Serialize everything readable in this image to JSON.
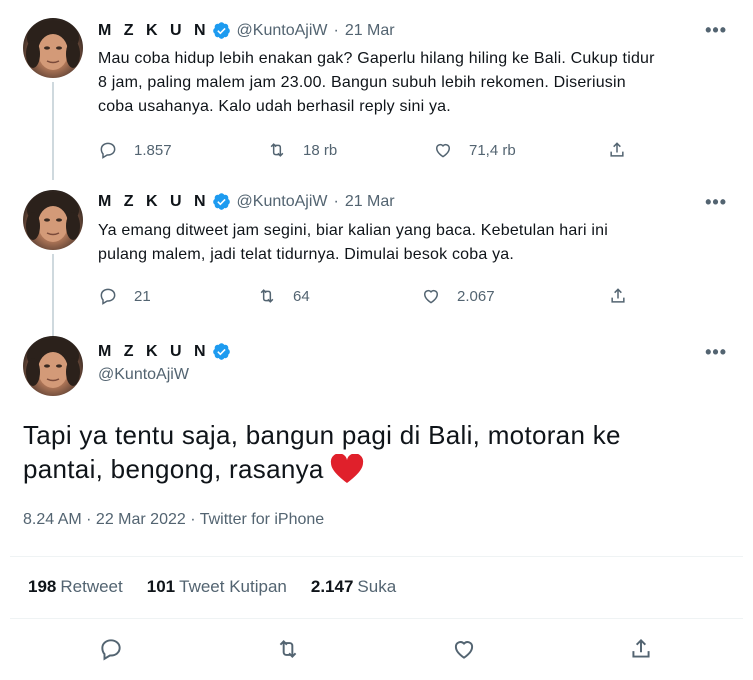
{
  "thread": [
    {
      "name": "M Z K U N",
      "handle": "@KuntoAjiW",
      "separator": "·",
      "date": "21 Mar",
      "text_lines": [
        "Mau coba hidup lebih enakan gak? Gaperlu hilang hiling ke Bali. Cukup tidur",
        "8 jam, paling malem jam 23.00. Bangun subuh lebih rekomen. Diseriusin",
        "coba usahanya. Kalo udah berhasil reply sini ya."
      ],
      "replies": "1.857",
      "retweets": "18 rb",
      "likes": "71,4 rb",
      "more": "•••"
    },
    {
      "name": "M Z K U N",
      "handle": "@KuntoAjiW",
      "separator": "·",
      "date": "21 Mar",
      "text_lines": [
        "Ya emang ditweet jam segini, biar kalian yang baca. Kebetulan hari ini",
        "pulang malem, jadi telat tidurnya. Dimulai besok coba ya."
      ],
      "replies": "21",
      "retweets": "64",
      "likes": "2.067",
      "more": "•••"
    }
  ],
  "main_tweet": {
    "name": "M Z K U N",
    "handle": "@KuntoAjiW",
    "more": "•••",
    "text_line1": "Tapi ya tentu saja, bangun pagi di Bali, motoran ke",
    "text_line2": "pantai, bengong, rasanya",
    "emoji": "red-heart",
    "meta": "8.24 AM · 22 Mar 2022 · Twitter for iPhone",
    "stats": {
      "retweet_count": "198",
      "retweet_label": "Retweet",
      "quote_count": "101",
      "quote_label": "Tweet Kutipan",
      "like_count": "2.147",
      "like_label": "Suka"
    }
  },
  "colors": {
    "verified": "#1d9bf0",
    "secondary_text": "#536471",
    "thread_line": "#cfd9de",
    "heart_emoji": "#e0202b"
  },
  "icons": [
    "reply-icon",
    "retweet-icon",
    "like-icon",
    "share-icon",
    "verified-badge-icon",
    "more-icon"
  ]
}
